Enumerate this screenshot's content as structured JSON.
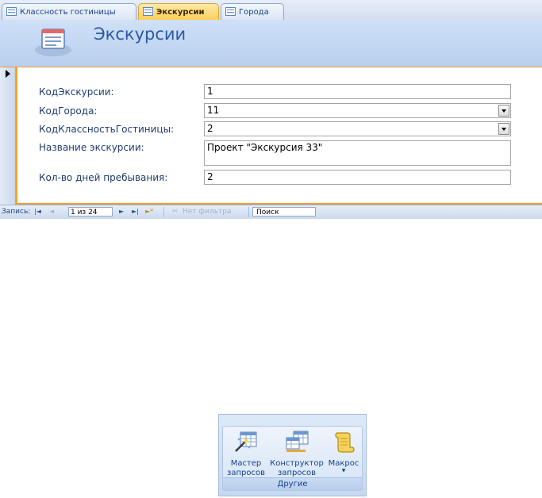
{
  "tabs": [
    {
      "label": "Классность гостиницы",
      "active": false
    },
    {
      "label": "Экскурсии",
      "active": true
    },
    {
      "label": "Города",
      "active": false
    }
  ],
  "form": {
    "title": "Экскурсии",
    "fields": [
      {
        "label": "КодЭкскурсии:",
        "value": "1",
        "type": "text"
      },
      {
        "label": "КодГорода:",
        "value": "11",
        "type": "combo"
      },
      {
        "label": "КодКлассностьГостиницы:",
        "value": "2",
        "type": "combo"
      },
      {
        "label": "Название экскурсии:",
        "value": "Проект \"Экскурсия 33\"",
        "type": "memo"
      },
      {
        "label": "Кол-во дней пребывания:",
        "value": "2",
        "type": "text"
      }
    ]
  },
  "navbar": {
    "record_label": "Запись:",
    "first": "|◄",
    "prev": "◄",
    "current": "1 из 24",
    "next": "►",
    "last": "►|",
    "new": "►*",
    "filter_label": "Нет фильтра",
    "search_label": "Поиск"
  },
  "ribbon": {
    "buttons": [
      {
        "line1": "Мастер",
        "line2": "запросов",
        "icon": "query-wizard-icon"
      },
      {
        "line1": "Конструктор",
        "line2": "запросов",
        "icon": "query-design-icon"
      },
      {
        "line1": "Макрос",
        "line2": "",
        "icon": "macro-scroll-icon"
      }
    ],
    "group_label": "Другие"
  },
  "colors": {
    "accent_orange": "#f0a030",
    "header_blue": "#b8cfee",
    "title_blue": "#2b5aa6"
  }
}
